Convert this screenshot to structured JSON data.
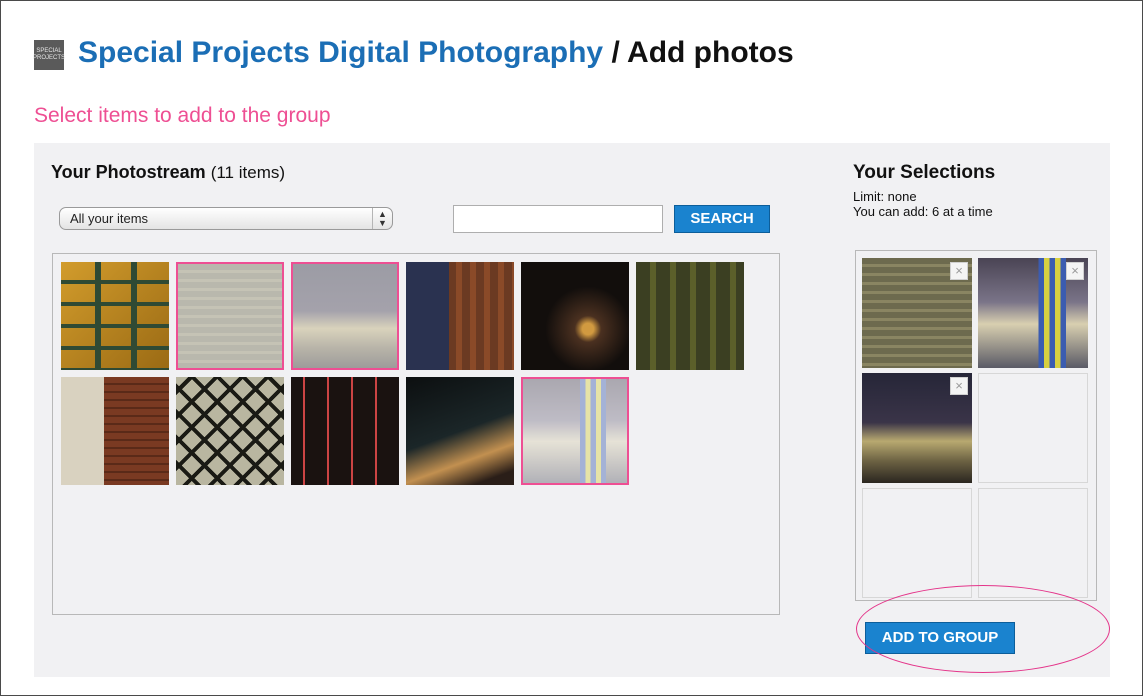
{
  "header": {
    "group_logo_text": "SPECIAL PROJECTS",
    "group_name": "Special Projects Digital Photography",
    "separator": " / ",
    "page_title": "Add photos"
  },
  "subtitle": "Select items to add to the group",
  "photostream": {
    "title": "Your Photostream",
    "count": "(11 items)",
    "filter_selected": "All your items",
    "search_value": "",
    "search_button": "SEARCH",
    "photos": [
      {
        "id": "ladder",
        "selected": false
      },
      {
        "id": "shed",
        "selected": true
      },
      {
        "id": "lot",
        "selected": true
      },
      {
        "id": "street",
        "selected": false
      },
      {
        "id": "dark",
        "selected": false
      },
      {
        "id": "green",
        "selected": false
      },
      {
        "id": "brick",
        "selected": false
      },
      {
        "id": "gate",
        "selected": false
      },
      {
        "id": "shop",
        "selected": false
      },
      {
        "id": "night",
        "selected": false
      },
      {
        "id": "ice",
        "selected": true
      }
    ]
  },
  "selections": {
    "title": "Your Selections",
    "limit": "Limit: none",
    "can_add": "You can add: 6 at a time",
    "remove_icon": "×",
    "slots": [
      "shed",
      "ice",
      "lot",
      "",
      "",
      ""
    ],
    "add_button": "ADD TO GROUP"
  },
  "colors": {
    "brand_blue": "#1b6eb5",
    "button_blue": "#1a83cf",
    "pink": "#ee4f93",
    "panel": "#f1f1f3"
  }
}
